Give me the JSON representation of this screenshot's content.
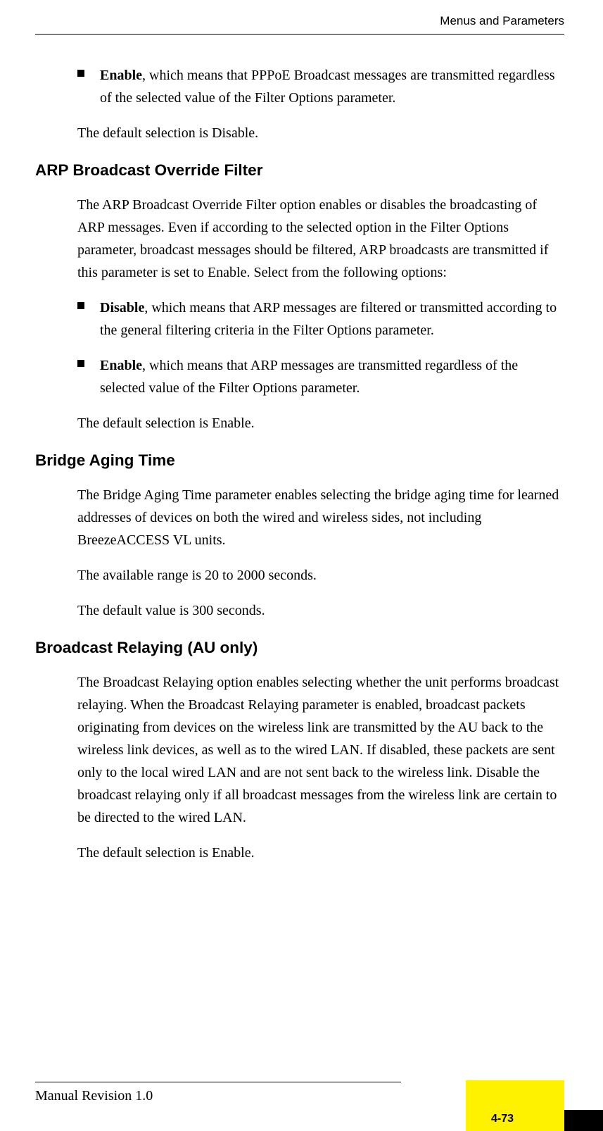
{
  "header": {
    "title": "Menus and Parameters"
  },
  "sections": [
    {
      "bullets": [
        {
          "bold_lead": "Enable",
          "rest": ", which means that PPPoE Broadcast messages are transmitted regardless of the selected value of the Filter Options parameter."
        }
      ],
      "paras_after": [
        "The default selection is Disable."
      ]
    },
    {
      "heading": "ARP Broadcast Override Filter",
      "paras_before": [
        "The ARP Broadcast Override Filter option enables or disables the broadcasting of ARP messages. Even if according to the selected option in the Filter Options parameter, broadcast messages should be filtered, ARP broadcasts are transmitted if this parameter is set to Enable. Select from the following options:"
      ],
      "bullets": [
        {
          "bold_lead": "Disable",
          "rest": ", which means that ARP messages are filtered or transmitted according to the general filtering criteria in the Filter Options parameter."
        },
        {
          "bold_lead": "Enable",
          "rest": ", which means that ARP messages are transmitted regardless of the selected value of the Filter Options parameter."
        }
      ],
      "paras_after": [
        "The default selection is Enable."
      ]
    },
    {
      "heading": "Bridge Aging Time",
      "paras_before": [
        "The Bridge Aging Time parameter enables selecting the bridge aging time for learned addresses of devices on both the wired and wireless sides, not including BreezeACCESS VL units.",
        "The available range is 20 to 2000 seconds.",
        "The default value is 300 seconds."
      ]
    },
    {
      "heading": "Broadcast Relaying (AU only)",
      "paras_before": [
        "The Broadcast Relaying option enables selecting whether the unit performs broadcast relaying. When the Broadcast Relaying parameter is enabled, broadcast packets originating from devices on the wireless link are transmitted by the AU back to the wireless link devices, as well as to the wired LAN. If disabled, these packets are sent only to the local wired LAN and are not sent back to the wireless link. Disable the broadcast relaying only if all broadcast messages from the wireless link are certain to be directed to the wired LAN.",
        "The default selection is Enable."
      ]
    }
  ],
  "footer": {
    "revision": "Manual Revision 1.0",
    "page_number": "4-73"
  }
}
